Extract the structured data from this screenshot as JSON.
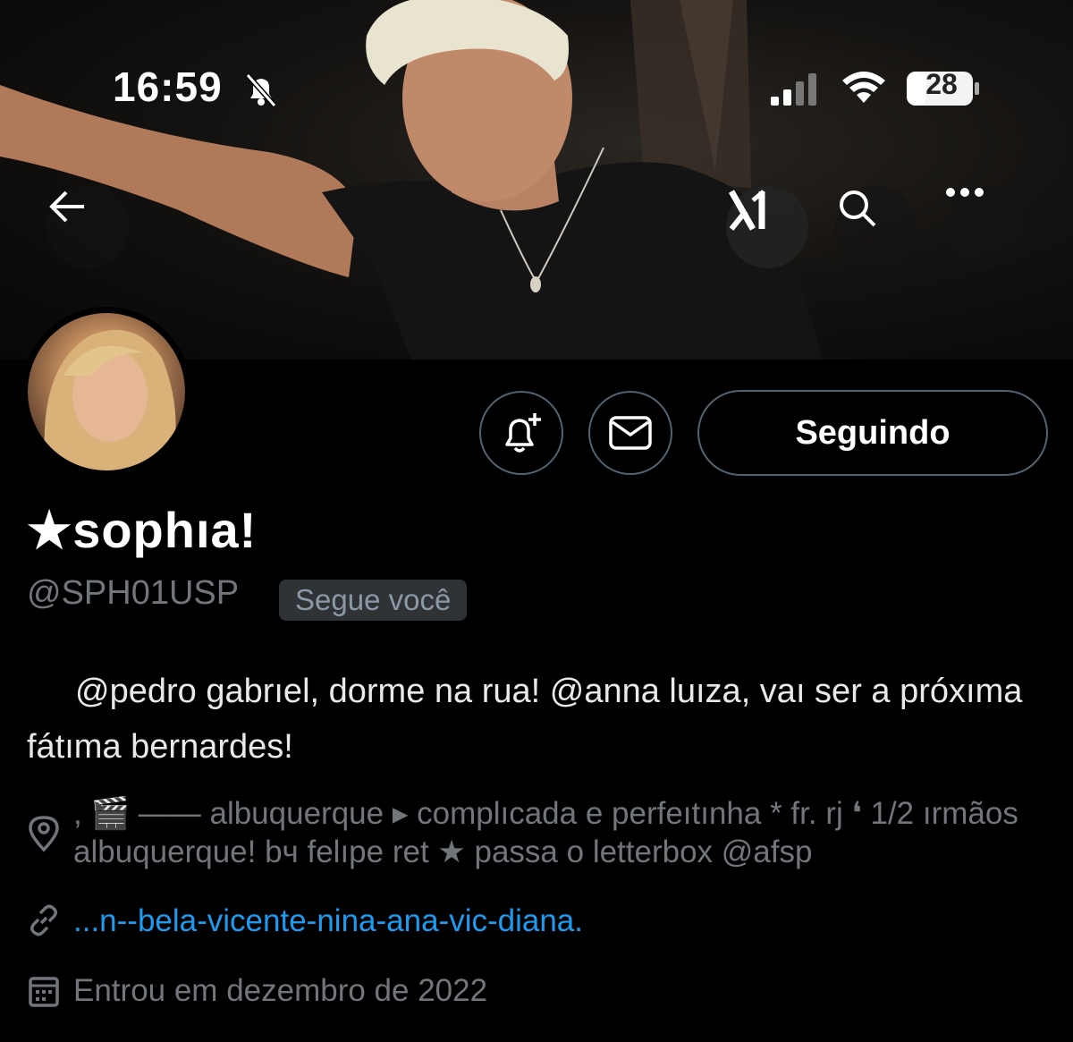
{
  "status_bar": {
    "time": "16:59",
    "battery": "28"
  },
  "header": {
    "grok_label": "X"
  },
  "profile": {
    "follow_button_label": "Seguindo",
    "display_name": "★sophıa!",
    "handle": "@SPH01USP",
    "follows_you_badge": "Segue você",
    "bio": "@pedro gabrıel, dorme na rua! @anna luıza, vaı ser a próxıma fátıma bernardes!",
    "location": ", 🎬 —— albuquerque ▸ complıcada e perfeıtınha * fr. rj ❛ 1/2 ırmãos albuquerque! bч felıpe ret ★ passa o letterbox @afsp",
    "link": "...n--bela-vicente-nina-ana-vic-diana.",
    "joined": "Entrou em dezembro de 2022"
  },
  "colors": {
    "background": "#000000",
    "text_primary": "#e7e9ea",
    "text_secondary": "#71767b",
    "link": "#1d9bf0",
    "border": "#536471"
  }
}
